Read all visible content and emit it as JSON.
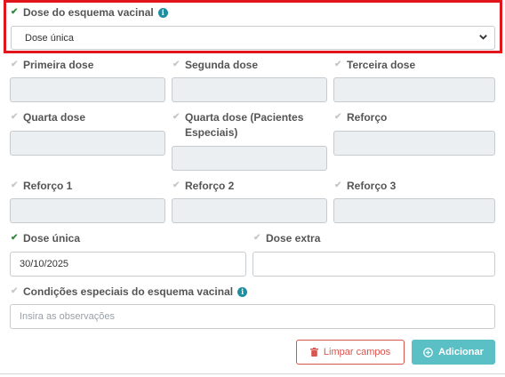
{
  "dose_esquema": {
    "label": "Dose do esquema vacinal",
    "selected": "Dose única"
  },
  "fields": {
    "primeira_dose": {
      "label": "Primeira dose",
      "value": ""
    },
    "segunda_dose": {
      "label": "Segunda dose",
      "value": ""
    },
    "terceira_dose": {
      "label": "Terceira dose",
      "value": ""
    },
    "quarta_dose": {
      "label": "Quarta dose",
      "value": ""
    },
    "quarta_dose_especiais": {
      "label_line1": "Quarta dose (Pacientes",
      "label_line2": "Especiais)",
      "value": ""
    },
    "reforco": {
      "label": "Reforço",
      "value": ""
    },
    "reforco_1": {
      "label": "Reforço 1",
      "value": ""
    },
    "reforco_2": {
      "label": "Reforço 2",
      "value": ""
    },
    "reforco_3": {
      "label": "Reforço 3",
      "value": ""
    },
    "dose_unica": {
      "label": "Dose única",
      "value": "30/10/2025"
    },
    "dose_extra": {
      "label": "Dose extra",
      "value": ""
    }
  },
  "condicoes": {
    "label": "Condições especiais do esquema vacinal",
    "placeholder": "Insira as observações"
  },
  "buttons": {
    "clear": "Limpar campos",
    "add": "Adicionar"
  },
  "colors": {
    "check_on": "#2e8b3c",
    "check_off": "#c8c8c8",
    "highlight": "#e0161c",
    "danger": "#d9534f",
    "primary": "#5bc0c6",
    "info": "#1e8fa0"
  },
  "icons": {
    "check": "check-icon",
    "info": "info-icon",
    "chevron": "chevron-down-icon",
    "trash": "trash-icon",
    "plus": "plus-circle-icon"
  }
}
